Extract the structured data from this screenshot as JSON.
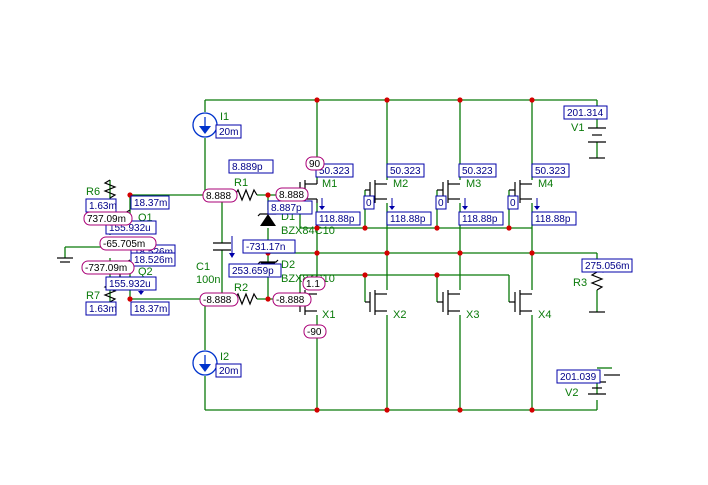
{
  "components": {
    "I1": {
      "name": "I1",
      "value": "20m"
    },
    "I2": {
      "name": "I2",
      "value": "20m"
    },
    "R1": {
      "name": "R1"
    },
    "R2": {
      "name": "R2"
    },
    "R3": {
      "name": "R3"
    },
    "R6": {
      "name": "R6"
    },
    "R7": {
      "name": "R7"
    },
    "C1": {
      "name": "C1",
      "value": "100n"
    },
    "D1": {
      "name": "D1",
      "model": "BZX84C10"
    },
    "D2": {
      "name": "D2",
      "model": "BZX84C10"
    },
    "Q1": {
      "name": "Q1"
    },
    "Q2": {
      "name": "Q2"
    },
    "M1": {
      "name": "M1"
    },
    "M2": {
      "name": "M2"
    },
    "M3": {
      "name": "M3"
    },
    "M4": {
      "name": "M4"
    },
    "X1": {
      "name": "X1"
    },
    "X2": {
      "name": "X2"
    },
    "X3": {
      "name": "X3"
    },
    "X4": {
      "name": "X4"
    },
    "V1": {
      "name": "V1"
    },
    "V2": {
      "name": "V2"
    }
  },
  "readouts": {
    "blue": {
      "i1_current": "20m",
      "i2_current": "20m",
      "r1_current": "8.889p",
      "r1_current_b": "8.887p",
      "d1_current": "-731.17n",
      "d2_current": "253.659p",
      "m1_current": "50.323",
      "m2_current": "50.323",
      "m3_current": "50.323",
      "m4_current": "50.323",
      "m1_gate": "118.88p",
      "m2_gate": "118.88p",
      "m3_gate": "118.88p",
      "m4_gate": "118.88p",
      "m2_zero": "0",
      "m3_zero": "0",
      "m4_zero": "0",
      "r6_value": "1.63m",
      "r7_value": "1.63m",
      "r6_current": "18.37m",
      "r7_current": "18.37m",
      "q1_ib": "155.932u",
      "q2_ib": "155.932u",
      "q_mid_a": "18.526m",
      "q_mid_b": "18.526m",
      "v1_current": "201.314",
      "v2_current": "201.039",
      "r3_current": "275.056m"
    },
    "pink": {
      "node_top": "8.888",
      "node_top_b": "8.888",
      "node_bottom": "-8.888",
      "node_bottom_b": "-8.888",
      "q1_base": "737.09m",
      "q2_base": "-737.09m",
      "q_mid": "-65.705m",
      "m1_drain": "90",
      "x1_drain": "-90",
      "x1_gate": "1.1"
    }
  }
}
